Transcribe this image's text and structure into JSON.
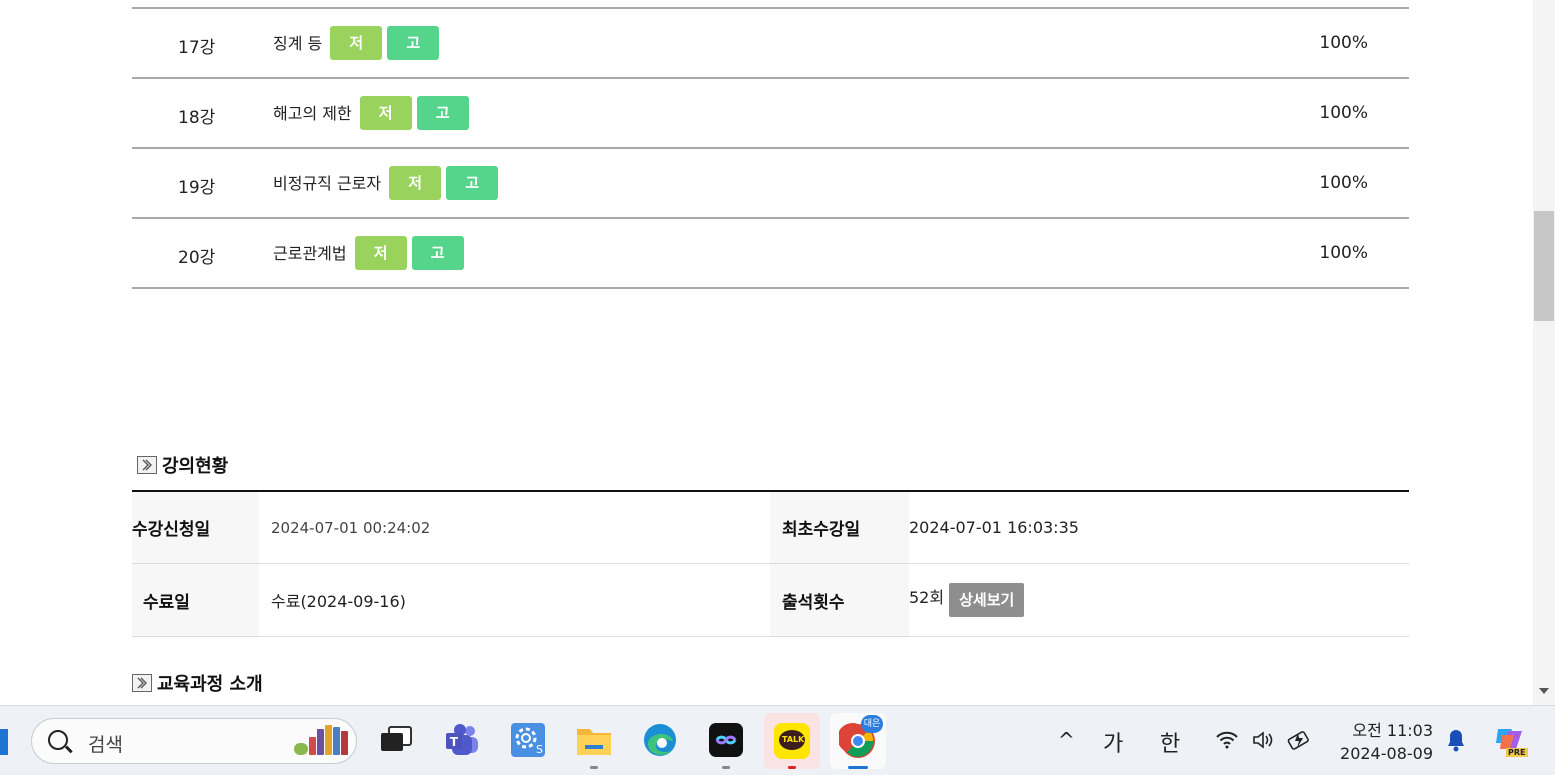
{
  "lectures": [
    {
      "num": "17강",
      "title": "징계 등",
      "btn_j": "저",
      "btn_g": "고",
      "progress": "100%"
    },
    {
      "num": "18강",
      "title": "해고의 제한",
      "btn_j": "저",
      "btn_g": "고",
      "progress": "100%"
    },
    {
      "num": "19강",
      "title": "비정규직 근로자",
      "btn_j": "저",
      "btn_g": "고",
      "progress": "100%"
    },
    {
      "num": "20강",
      "title": "근로관계법",
      "btn_j": "저",
      "btn_g": "고",
      "progress": "100%"
    }
  ],
  "status_section": {
    "title": "강의현황",
    "rows": [
      {
        "label1": "수강신청일",
        "value1": "2024-07-01 00:24:02",
        "label2": "최초수강일",
        "value2": "2024-07-01 16:03:35"
      },
      {
        "label1": "수료일",
        "value1": "수료(2024-09-16)",
        "label2": "출석횟수",
        "value2": "52회",
        "button": "상세보기"
      }
    ]
  },
  "intro_section": {
    "title": "교육과정 소개"
  },
  "taskbar": {
    "search_placeholder": "검색",
    "apps": [
      "task-view-icon",
      "teams-icon",
      "settings-icon",
      "file-explorer-icon",
      "edge-icon",
      "capcut-icon",
      "kakaotalk-icon",
      "chrome-icon"
    ],
    "kakao_label": "TALK",
    "chrome_badge": "대은",
    "tray": {
      "chevron": "^",
      "ime1": "가",
      "ime2": "한"
    },
    "clock": {
      "time": "오전 11:03",
      "date": "2024-08-09"
    },
    "copilot_badge": "PRE"
  },
  "colors": {
    "btn_j": "#99d35d",
    "btn_g": "#55d58c",
    "detail_btn": "#8e8e8e",
    "accent_blue": "#1e74d3"
  }
}
